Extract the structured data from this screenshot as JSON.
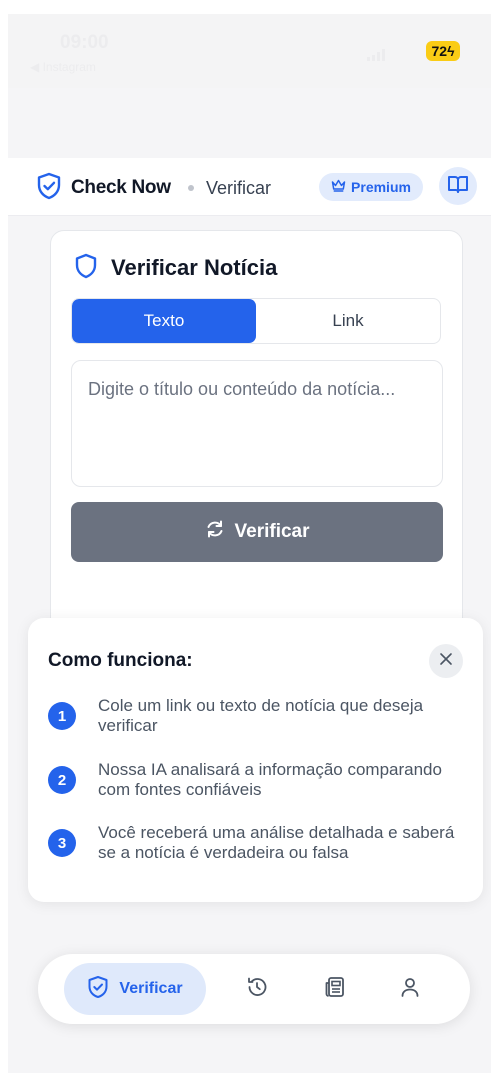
{
  "status_bar": {
    "time": "09:00",
    "back_label": "◀ Instagram",
    "battery": "72"
  },
  "header": {
    "app_name": "Check Now",
    "section": "Verificar",
    "premium_label": "Premium"
  },
  "verify_card": {
    "title": "Verificar Notícia",
    "tabs": [
      {
        "label": "Texto",
        "active": true
      },
      {
        "label": "Link",
        "active": false
      }
    ],
    "input_placeholder": "Digite o título ou conteúdo da notícia...",
    "input_value": "",
    "submit_label": "Verificar"
  },
  "how_it_works": {
    "title": "Como funciona:",
    "steps": [
      {
        "number": "1",
        "text": "Cole um link ou texto de notícia que deseja verificar"
      },
      {
        "number": "2",
        "text": "Nossa IA analisará a informação comparando com fontes confiáveis"
      },
      {
        "number": "3",
        "text": "Você receberá uma análise detalhada e saberá se a notícia é verdadeira ou falsa"
      }
    ]
  },
  "bottom_nav": {
    "items": [
      {
        "label": "Verificar",
        "icon": "shield-check-icon",
        "active": true
      },
      {
        "label": "",
        "icon": "history-icon",
        "active": false
      },
      {
        "label": "",
        "icon": "news-icon",
        "active": false
      },
      {
        "label": "",
        "icon": "profile-icon",
        "active": false
      }
    ]
  },
  "colors": {
    "primary": "#2463eb",
    "premium_bg": "#e2ebfc",
    "disabled_button": "#6b7280",
    "battery": "#facc15"
  }
}
